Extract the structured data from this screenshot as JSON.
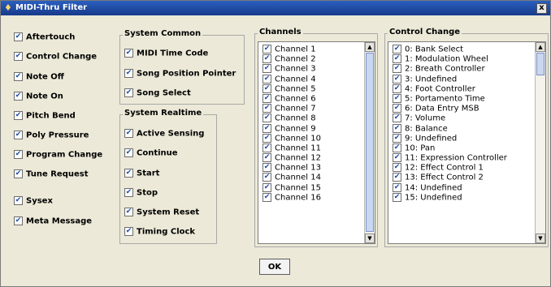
{
  "window": {
    "title": "MIDI-Thru Filter",
    "close_label": "x"
  },
  "message_types": [
    "Aftertouch",
    "Control Change",
    "Note Off",
    "Note On",
    "Pitch Bend",
    "Poly Pressure",
    "Program Change",
    "Tune Request",
    "Sysex",
    "Meta Message"
  ],
  "system_common": {
    "title": "System Common",
    "items": [
      "MIDI Time Code",
      "Song Position Pointer",
      "Song Select"
    ]
  },
  "system_realtime": {
    "title": "System Realtime",
    "items": [
      "Active Sensing",
      "Continue",
      "Start",
      "Stop",
      "System Reset",
      "Timing Clock"
    ]
  },
  "channels": {
    "title": "Channels",
    "items": [
      "Channel 1",
      "Channel 2",
      "Channel 3",
      "Channel 4",
      "Channel 5",
      "Channel 6",
      "Channel 7",
      "Channel 8",
      "Channel 9",
      "Channel 10",
      "Channel 11",
      "Channel 12",
      "Channel 13",
      "Channel 14",
      "Channel 15",
      "Channel 16"
    ]
  },
  "control_change": {
    "title": "Control Change",
    "items": [
      "0: Bank Select",
      "1: Modulation Wheel",
      "2: Breath Controller",
      "3: Undefined",
      "4: Foot Controller",
      "5: Portamento Time",
      "6: Data Entry MSB",
      "7: Volume",
      "8: Balance",
      "9: Undefined",
      "10: Pan",
      "11: Expression Controller",
      "12: Effect Control 1",
      "13: Effect Control 2",
      "14: Undefined",
      "15: Undefined"
    ]
  },
  "ok_label": "OK",
  "check_glyph": "✔"
}
